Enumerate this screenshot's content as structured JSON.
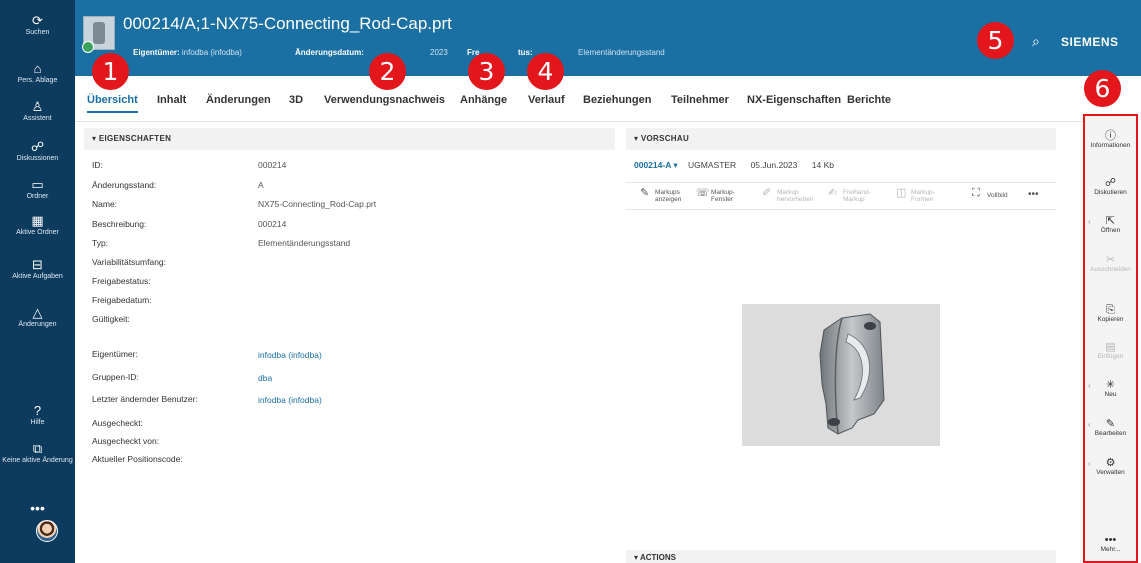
{
  "leftnav": [
    {
      "icon": "⟳",
      "label": "Suchen"
    },
    {
      "icon": "⌂",
      "label": "Pers. Ablage"
    },
    {
      "icon": "♙",
      "label": "Assistent"
    },
    {
      "icon": "☍",
      "label": "Diskussionen"
    },
    {
      "icon": "▭",
      "label": "Ordner"
    },
    {
      "icon": "▦",
      "label": "Aktive Ordner"
    },
    {
      "icon": "⊟",
      "label": "Aktive Aufgaben"
    },
    {
      "icon": "△",
      "label": "Änderungen"
    },
    {
      "icon": "?",
      "label": "Hilfe"
    },
    {
      "icon": "⧉",
      "label": "Keine aktive Änderung"
    }
  ],
  "more_dots": "•••",
  "header": {
    "title": "000214/A;1-NX75-Connecting_Rod-Cap.prt",
    "owner_label": "Eigentümer:",
    "owner_value": "infodba (infodba)",
    "date_label": "Änderungsdatum:",
    "date_value": "2023",
    "status_label": "Fre",
    "status_label2": "tus:",
    "type_value": "Elementänderungsstand",
    "search_icon": "⌕",
    "brand": "SIEMENS"
  },
  "callouts": [
    "1",
    "2",
    "3",
    "4",
    "5",
    "6"
  ],
  "tabs": [
    "Übersicht",
    "Inhalt",
    "Änderungen",
    "3D",
    "Verwendungsnachweis",
    "Anhänge",
    "Verlauf",
    "Beziehungen",
    "Teilnehmer",
    "NX-Eigenschaften",
    "Berichte"
  ],
  "properties": {
    "heading": "▾ EIGENSCHAFTEN",
    "rows": [
      {
        "label": "ID:",
        "value": "000214"
      },
      {
        "label": "Änderungsstand:",
        "value": "A"
      },
      {
        "label": "Name:",
        "value": "NX75-Connecting_Rod-Cap.prt"
      },
      {
        "label": "Beschreibung:",
        "value": "000214"
      },
      {
        "label": "Typ:",
        "value": "Elementänderungsstand"
      },
      {
        "label": "Variabilitätsumfang:",
        "value": ""
      },
      {
        "label": "Freigabestatus:",
        "value": ""
      },
      {
        "label": "Freigabedatum:",
        "value": ""
      },
      {
        "label": "Gültigkeit:",
        "value": ""
      },
      {
        "label": "Eigentümer:",
        "value": "infodba (infodba)"
      },
      {
        "label": "Gruppen-ID:",
        "value": "dba"
      },
      {
        "label": "Letzter ändernder Benutzer:",
        "value": "infodba (infodba)"
      },
      {
        "label": "Ausgecheckt:",
        "value": ""
      },
      {
        "label": "Ausgecheckt von:",
        "value": ""
      },
      {
        "label": "Aktueller Positionscode:",
        "value": ""
      }
    ]
  },
  "preview": {
    "heading": "▾ VORSCHAU",
    "revision": "000214-A ▾",
    "dataset_type": "UGMASTER",
    "date": "05.Jun.2023",
    "size": "14 Kb",
    "tools": [
      {
        "icon": "✎",
        "label": "Markups anzeigen"
      },
      {
        "icon": "☏",
        "label": "Markup-Fenster"
      },
      {
        "icon": "✐",
        "label": "Markup hervorheben"
      },
      {
        "icon": "✍",
        "label": "Freihand-Markup"
      },
      {
        "icon": "◫",
        "label": "Markup-Formen"
      },
      {
        "icon": "⛶",
        "label": "Vollbild"
      },
      {
        "icon": "",
        "label": "•••"
      }
    ]
  },
  "actions_heading": "▾ ACTIONS",
  "commands": [
    {
      "icon": "ⓘ",
      "label": "Informationen"
    },
    {
      "icon": "☍",
      "label": "Diskutieren"
    },
    {
      "icon": "⇱",
      "label": "Öffnen"
    },
    {
      "icon": "✂",
      "label": "Ausschneiden"
    },
    {
      "icon": "⎘",
      "label": "Kopieren"
    },
    {
      "icon": "▤",
      "label": "Einfügen"
    },
    {
      "icon": "✳",
      "label": "Neu"
    },
    {
      "icon": "✎",
      "label": "Bearbeiten"
    },
    {
      "icon": "⚙",
      "label": "Verwalten"
    },
    {
      "icon": "•••",
      "label": "Mehr..."
    }
  ],
  "colors": {
    "nav": "#0d3b5e",
    "header": "#1a6fa3",
    "callout": "#e2161b"
  }
}
